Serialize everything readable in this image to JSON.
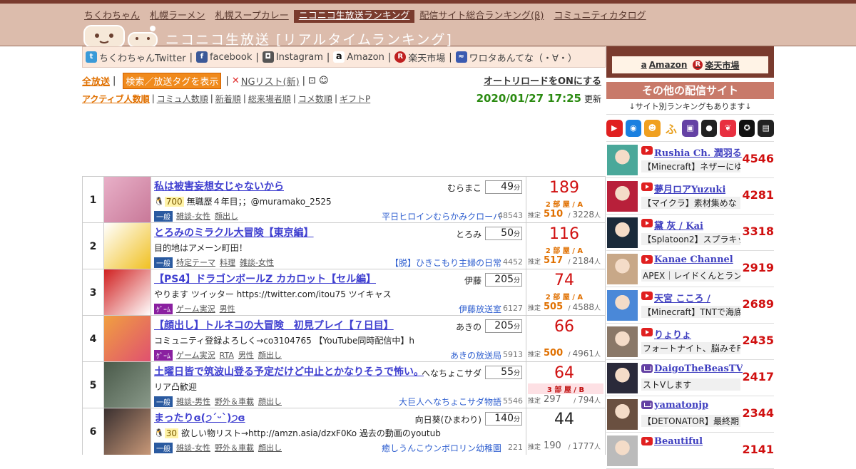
{
  "nav": {
    "items": [
      {
        "label": "ちくわちゃん",
        "active": false
      },
      {
        "label": "札幌ラーメン",
        "active": false
      },
      {
        "label": "札幌スープカレー",
        "active": false
      },
      {
        "label": "ニコニコ生放送ランキング",
        "active": true
      },
      {
        "label": "配信サイト総合ランキング(β)",
        "active": false
      },
      {
        "label": "コミュニティカタログ",
        "active": false
      }
    ]
  },
  "site_title": "ニコニコ生放送 [リアルタイムランキング]",
  "linkbar": {
    "twitter": "ちくわちゃんTwitter",
    "facebook": "facebook",
    "instagram": "Instagram",
    "amazon": "Amazon",
    "rakuten": "楽天市場",
    "wrotta": "ワロタあんてな（・∀・）"
  },
  "controls": {
    "all_streams": "全放送",
    "search_tag": "検索／放送タグを表示",
    "ng_list": "NGリスト(新)",
    "auto_reload": "オートリロードをONにする",
    "sort": [
      "アクティブ人数順",
      "コミュ人数順",
      "新着順",
      "総来場者順",
      "コメ数順",
      "ギフトP"
    ],
    "timestamp": "2020/01/27 17:25",
    "updated": "更新"
  },
  "rows": [
    {
      "rank": "1",
      "title": "私は被害妄想女じゃないから",
      "owner": "むらまこ",
      "minutes": "49",
      "level": "700",
      "desc": "無職歴４年目；；@muramako_2525",
      "category": "一般",
      "cat_type": "gen",
      "tags": [
        "雑談-女性",
        "顔出し"
      ],
      "community": "平日ヒロインむらかみクローバ",
      "community_count": "48543",
      "viewers": "189",
      "room": "2 部 屋 / A",
      "room_style": "orange",
      "est_label": "推定",
      "est_active": "510",
      "est_total": "3228",
      "unit": "人",
      "min_unit": "分"
    },
    {
      "rank": "2",
      "title": "とろみのミラクル大冒険【東京編】",
      "owner": "とろみ",
      "minutes": "50",
      "level": "",
      "desc": "目的地はアメーン町田！",
      "category": "一般",
      "cat_type": "gen",
      "tags": [
        "特定テーマ",
        "料理",
        "雑談-女性"
      ],
      "community": "【脱】ひきこもり主婦の日常",
      "community_count": "4452",
      "viewers": "116",
      "room": "2 部 屋 / A",
      "room_style": "orange",
      "est_label": "推定",
      "est_active": "517",
      "est_total": "2184",
      "unit": "人",
      "min_unit": "分"
    },
    {
      "rank": "3",
      "title": "【PS4】ドラゴンボールZ カカロット【セル編】",
      "owner": "伊藤",
      "minutes": "205",
      "level": "",
      "desc": "やります ツイッター https://twitter.com/itou75 ツイキャス",
      "category": "ｹﾞｰﾑ",
      "cat_type": "game",
      "tags": [
        "ゲーム実況",
        "男性"
      ],
      "community": "伊藤放送室",
      "community_count": "6127",
      "viewers": "74",
      "room": "2 部 屋 / A",
      "room_style": "orange",
      "est_label": "推定",
      "est_active": "505",
      "est_total": "4588",
      "unit": "人",
      "min_unit": "分"
    },
    {
      "rank": "4",
      "title": "【顔出し】トルネコの大冒険　初見プレイ【７日目】",
      "owner": "あきの",
      "minutes": "205",
      "level": "",
      "desc": "コミュニティ登録よろしく→co3104765 【YouTube同時配信中】h",
      "category": "ｹﾞｰﾑ",
      "cat_type": "game",
      "tags": [
        "ゲーム実況",
        "RTA",
        "男性",
        "顔出し"
      ],
      "community": "あきの放送局",
      "community_count": "5913",
      "viewers": "66",
      "room": "",
      "room_style": "orange",
      "est_label": "推定",
      "est_active": "500",
      "est_total": "4961",
      "unit": "人",
      "min_unit": "分"
    },
    {
      "rank": "5",
      "title": "土曜日皆で筑波山登る予定だけど中止とかなりそうで怖い。",
      "owner": "へなちょこサダ",
      "minutes": "55",
      "level": "",
      "desc": "リア凸歓迎",
      "category": "一般",
      "cat_type": "gen",
      "tags": [
        "雑談-男性",
        "野外＆車載",
        "顔出し"
      ],
      "community": "大巨人へなちょこサダ物語",
      "community_count": "5546",
      "viewers": "64",
      "room": "3 部 屋 / B",
      "room_style": "pink",
      "est_label": "推定",
      "est_active": "297",
      "est_total": "794",
      "unit": "人",
      "min_unit": "分"
    },
    {
      "rank": "6",
      "title": "まったりɞ(੭ˊᵕˋ)੭ɞ",
      "owner": "向日葵(ひまわり)",
      "minutes": "140",
      "level": "30",
      "desc": "欲しい物リスト→http://amzn.asia/dzxF0Ko 過去の動画のyoutub",
      "category": "一般",
      "cat_type": "gen",
      "tags": [
        "雑談-女性",
        "野外＆車載",
        "顔出し"
      ],
      "community": "癒しうんこウンボロリン幼稚園",
      "community_count": "221",
      "viewers": "44",
      "room": "",
      "room_style": "black",
      "est_label": "推定",
      "est_active": "190",
      "est_total": "1777",
      "unit": "人",
      "min_unit": "分"
    }
  ],
  "sidebar": {
    "amazon": "Amazon",
    "rakuten": "楽天市場",
    "other_title": "その他の配信サイト",
    "other_sub": "↓サイト別ランキングもあります↓",
    "site_icons": [
      {
        "name": "youtube-icon",
        "color": "#e02020",
        "glyph": "▶"
      },
      {
        "name": "openrec-icon",
        "color": "#1a80e0",
        "glyph": "◉"
      },
      {
        "name": "mildom-icon",
        "color": "#f0a020",
        "glyph": "☻"
      },
      {
        "name": "fuwa-icon",
        "color": "#ffffff",
        "glyph": "ふ"
      },
      {
        "name": "twitch-icon",
        "color": "#6441a4",
        "glyph": "▣"
      },
      {
        "name": "showroom-icon",
        "color": "#222222",
        "glyph": "●"
      },
      {
        "name": "17live-icon",
        "color": "#e83040",
        "glyph": "❦"
      },
      {
        "name": "cat-icon",
        "color": "#111111",
        "glyph": "✪"
      },
      {
        "name": "tv-icon",
        "color": "#222222",
        "glyph": "▤"
      }
    ],
    "streamers": [
      {
        "name": "Rushia Ch. 潤羽る",
        "platform": "yt",
        "title": "【Minecraft】ネザーにゆ",
        "count": "4546",
        "avatar_color": "#4aa89a"
      },
      {
        "name": "夢月ロアYuzuki",
        "platform": "yt",
        "title": "【マイクラ】素材集めな",
        "count": "4281",
        "avatar_color": "#b8203a"
      },
      {
        "name": "黛 灰 / Kai",
        "platform": "yt",
        "title": "【Splatoon2】スプラキッ",
        "count": "3318",
        "avatar_color": "#1a2a3a"
      },
      {
        "name": "Kanae Channel",
        "platform": "yt",
        "title": "APEX｜レイドくんとラン",
        "count": "2919",
        "avatar_color": "#c8a888"
      },
      {
        "name": "天宮 こころ /",
        "platform": "yt",
        "title": "【Minecraft】TNTで海底神",
        "count": "2689",
        "avatar_color": "#4a88d8"
      },
      {
        "name": "りょりょ",
        "platform": "yt",
        "title": "フォートナイト、脳みそF",
        "count": "2435",
        "avatar_color": "#8a7868"
      },
      {
        "name": "DaigoTheBeasTV",
        "platform": "tw",
        "title": "ストVします",
        "count": "2417",
        "avatar_color": "#2a2a3a"
      },
      {
        "name": "yamatonjp",
        "platform": "tw",
        "title": "【DETONATOR】最終期",
        "count": "2344",
        "avatar_color": "#6a5040"
      },
      {
        "name": "Beautiful",
        "platform": "yt",
        "title": "",
        "count": "2141",
        "avatar_color": "#bbbbbb"
      }
    ]
  }
}
